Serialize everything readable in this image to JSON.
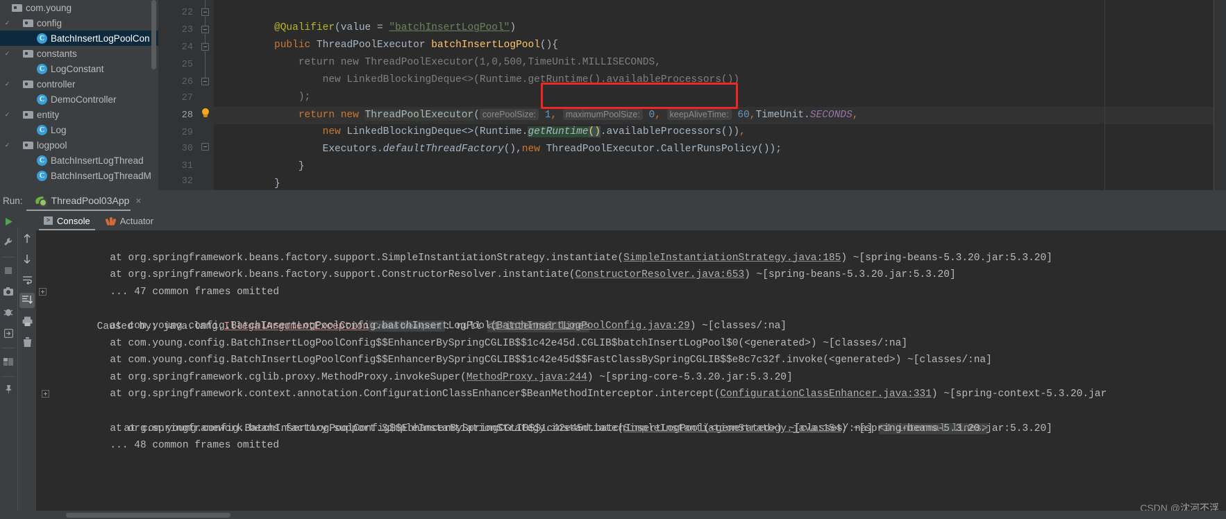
{
  "project_tree": {
    "items": [
      {
        "label": "com.young",
        "type": "package",
        "depth": 0,
        "arrow": "",
        "selected": false
      },
      {
        "label": "config",
        "type": "folder",
        "depth": 1,
        "arrow": "v",
        "selected": false
      },
      {
        "label": "BatchInsertLogPoolCon",
        "type": "class",
        "depth": 2,
        "arrow": "",
        "selected": true
      },
      {
        "label": "constants",
        "type": "folder",
        "depth": 1,
        "arrow": "v",
        "selected": false
      },
      {
        "label": "LogConstant",
        "type": "class",
        "depth": 2,
        "arrow": "",
        "selected": false
      },
      {
        "label": "controller",
        "type": "folder",
        "depth": 1,
        "arrow": "v",
        "selected": false
      },
      {
        "label": "DemoController",
        "type": "class",
        "depth": 2,
        "arrow": "",
        "selected": false
      },
      {
        "label": "entity",
        "type": "folder",
        "depth": 1,
        "arrow": "v",
        "selected": false
      },
      {
        "label": "Log",
        "type": "class",
        "depth": 2,
        "arrow": "",
        "selected": false
      },
      {
        "label": "logpool",
        "type": "folder",
        "depth": 1,
        "arrow": "v",
        "selected": false
      },
      {
        "label": "BatchInsertLogThread",
        "type": "class",
        "depth": 2,
        "arrow": "",
        "selected": false
      },
      {
        "label": "BatchInsertLogThreadM",
        "type": "class",
        "depth": 2,
        "arrow": "",
        "selected": false
      }
    ]
  },
  "editor": {
    "line_numbers": [
      "22",
      "23",
      "24",
      "25",
      "26",
      "27",
      "28",
      "29",
      "30",
      "31",
      "32"
    ],
    "current_line": "28",
    "lines": [
      {
        "n": "22",
        "text": "    @Qualifier(value = \"batchInsertLogPool\")"
      },
      {
        "n": "23",
        "text": "    public ThreadPoolExecutor batchInsertLogPool(){"
      },
      {
        "n": "24",
        "text": "//        return new ThreadPoolExecutor(1,0,500,TimeUnit.MILLISECONDS,"
      },
      {
        "n": "25",
        "text": "//            new LinkedBlockingDeque<>(Runtime.getRuntime().availableProcessors())"
      },
      {
        "n": "26",
        "text": "//        );"
      },
      {
        "n": "27",
        "text": "        return new ThreadPoolExecutor( corePoolSize: 1, maximumPoolSize: 0, keepAliveTime: 60,TimeUnit.SECONDS,"
      },
      {
        "n": "28",
        "text": "            new LinkedBlockingDeque<>(Runtime.getRuntime().availableProcessors()),"
      },
      {
        "n": "29",
        "text": "            Executors.defaultThreadFactory(),new ThreadPoolExecutor.CallerRunsPolicy());"
      },
      {
        "n": "30",
        "text": "    }"
      },
      {
        "n": "31",
        "text": "}"
      }
    ],
    "param_hints": [
      {
        "name": "corePoolSize:",
        "value": "1"
      },
      {
        "name": "maximumPoolSize:",
        "value": "0"
      },
      {
        "name": "keepAliveTime:",
        "value": "60"
      }
    ],
    "tokens": {
      "annotation": "@Qualifier",
      "qualifier_value_key": "value",
      "qualifier_value": "\"batchInsertLogPool\"",
      "public_kw": "public",
      "type_name": "ThreadPoolExecutor",
      "method_name": "batchInsertLogPool",
      "return_kw": "return",
      "new_kw": "new",
      "time_unit_seconds": "TimeUnit.SECONDS",
      "deque": "LinkedBlockingDeque<>",
      "runtime": "Runtime.",
      "get_runtime": "getRuntime",
      "available_processors": ".availableProcessors()",
      "executors": "Executors.",
      "default_thread_factory": "defaultThreadFactory",
      "caller_runs": "ThreadPoolExecutor.CallerRunsPolicy());"
    }
  },
  "run_window": {
    "run_label": "Run:",
    "tab_name": "ThreadPool03App",
    "close_glyph": "×",
    "tabs": [
      {
        "label": "Console",
        "icon": "console-icon",
        "selected": true
      },
      {
        "label": "Actuator",
        "icon": "actuator-icon",
        "selected": false
      }
    ],
    "left_toolbar": [
      {
        "name": "rerun-button",
        "glyph": "▶"
      },
      {
        "name": "settings-button",
        "glyph": "ᴠ"
      },
      {
        "name": "stop-button",
        "glyph": "■"
      },
      {
        "name": "camera-button",
        "glyph": "◎"
      },
      {
        "name": "debug-button",
        "glyph": "✷"
      },
      {
        "name": "export-button",
        "glyph": "↱"
      },
      {
        "name": "layout-button",
        "glyph": "▤"
      },
      {
        "name": "pin-button",
        "glyph": "⚓"
      }
    ],
    "console_toolbar": [
      {
        "name": "up-button",
        "glyph": "↑"
      },
      {
        "name": "down-button",
        "glyph": "↓"
      },
      {
        "name": "soft-wrap-button",
        "glyph": "↩"
      },
      {
        "name": "scroll-to-end-button",
        "glyph": "↧",
        "active": true
      },
      {
        "name": "print-button",
        "glyph": "⎙"
      },
      {
        "name": "clear-all-button",
        "glyph": "Ὕ1"
      }
    ]
  },
  "console": {
    "lines": [
      {
        "indent": 0,
        "expander": false,
        "segments": [
          {
            "t": "    at org.springframework.beans.factory.support.SimpleInstantiationStrategy.instantiate(",
            "c": "plain"
          },
          {
            "t": "SimpleInstantiationStrategy.java:185",
            "c": "link"
          },
          {
            "t": ") ~[spring-beans-5.3.20.jar:5.3.20]",
            "c": "plain"
          }
        ]
      },
      {
        "indent": 0,
        "expander": false,
        "segments": [
          {
            "t": "    at org.springframework.beans.factory.support.ConstructorResolver.instantiate(",
            "c": "plain"
          },
          {
            "t": "ConstructorResolver.java:653",
            "c": "link"
          },
          {
            "t": ") ~[spring-beans-5.3.20.jar:5.3.20]",
            "c": "plain"
          }
        ]
      },
      {
        "indent": 0,
        "expander": false,
        "segments": [
          {
            "t": "    ... 47 common frames omitted",
            "c": "plain"
          }
        ]
      },
      {
        "indent": 0,
        "expander": true,
        "segments": [
          {
            "t": "Caused by: java.lang.",
            "c": "plain"
          },
          {
            "t": "IllegalArgumentException",
            "c": "exc-link"
          },
          {
            "t": "Create breakpoint",
            "c": "chip"
          },
          {
            "t": ": null ",
            "c": "plain"
          },
          {
            "t": "<1 internal line>",
            "c": "internal"
          }
        ]
      },
      {
        "indent": 0,
        "expander": false,
        "segments": [
          {
            "t": "    at com.young.config.BatchInsertLogPoolConfig.batchInsertLogPool(",
            "c": "plain"
          },
          {
            "t": "BatchInsertLogPoolConfig.java:29",
            "c": "link"
          },
          {
            "t": ") ~[classes/:na]",
            "c": "plain"
          }
        ]
      },
      {
        "indent": 0,
        "expander": false,
        "segments": [
          {
            "t": "    at com.young.config.BatchInsertLogPoolConfig$$EnhancerBySpringCGLIB$$1c42e45d.CGLIB$batchInsertLogPool$0(<generated>) ~[classes/:na]",
            "c": "plain"
          }
        ]
      },
      {
        "indent": 0,
        "expander": false,
        "segments": [
          {
            "t": "    at com.young.config.BatchInsertLogPoolConfig$$EnhancerBySpringCGLIB$$1c42e45d$$FastClassBySpringCGLIB$$e8c7c32f.invoke(<generated>) ~[classes/:na]",
            "c": "plain"
          }
        ]
      },
      {
        "indent": 0,
        "expander": false,
        "segments": [
          {
            "t": "    at org.springframework.cglib.proxy.MethodProxy.invokeSuper(",
            "c": "plain"
          },
          {
            "t": "MethodProxy.java:244",
            "c": "link"
          },
          {
            "t": ") ~[spring-core-5.3.20.jar:5.3.20]",
            "c": "plain"
          }
        ]
      },
      {
        "indent": 0,
        "expander": false,
        "segments": [
          {
            "t": "    at org.springframework.context.annotation.ConfigurationClassEnhancer$BeanMethodInterceptor.intercept(",
            "c": "plain"
          },
          {
            "t": "ConfigurationClassEnhancer.java:331",
            "c": "link"
          },
          {
            "t": ") ~[spring-context-5.3.20.jar",
            "c": "plain"
          }
        ]
      },
      {
        "indent": 0,
        "expander": true,
        "segments": [
          {
            "t": "    at com.young.config.BatchInsertLogPoolConfig$$EnhancerBySpringCGLIB$$1c42e45d.batchInsertLogPool(<generated>) ~[classes/:na] ",
            "c": "plain"
          },
          {
            "t": "<4 internal lines>",
            "c": "internal"
          }
        ]
      },
      {
        "indent": 0,
        "expander": false,
        "segments": [
          {
            "t": "    at org.springframework.beans.factory.support.SimpleInstantiationStrategy.instantiate(",
            "c": "plain"
          },
          {
            "t": "SimpleInstantiationStrategy.java:154",
            "c": "link"
          },
          {
            "t": ") ~[spring-beans-5.3.20.jar:5.3.20]",
            "c": "plain"
          }
        ]
      },
      {
        "indent": 0,
        "expander": false,
        "segments": [
          {
            "t": "    ... 48 common frames omitted",
            "c": "plain"
          }
        ]
      }
    ]
  },
  "watermark": {
    "prefix": "CSDN @",
    "author": "沈河不浮"
  },
  "colors": {
    "editor_bg": "#2b2b2b",
    "panel_bg": "#3c3f41",
    "selection_blue": "#0d293e",
    "accent_red": "#ef2626",
    "keyword_orange": "#cc7832",
    "string_green": "#6a8759",
    "method_yellow": "#ffc66d",
    "number_blue": "#6897bb",
    "class_icon_blue": "#389fd6"
  }
}
